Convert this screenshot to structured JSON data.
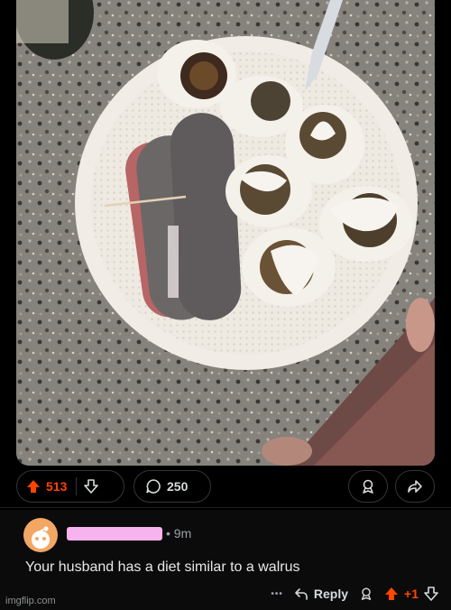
{
  "post": {
    "image_alt": "Plate with dark rolled wraps, salami and deviled eggs topped with sauce",
    "upvotes": "513",
    "comments": "250"
  },
  "comment": {
    "time": "• 9m",
    "text": "Your husband has a diet similar to a walrus",
    "reply_label": "Reply",
    "score": "+1",
    "more": "•••"
  },
  "watermark": "imgflip.com",
  "colors": {
    "background": "#000000",
    "upvote": "#ff4500",
    "username_redaction": "#f6b3ee",
    "avatar": "#f3a765"
  },
  "icons": [
    "upvote-icon",
    "downvote-icon",
    "comment-bubble-icon",
    "award-icon",
    "share-icon",
    "reply-arrow-icon"
  ]
}
